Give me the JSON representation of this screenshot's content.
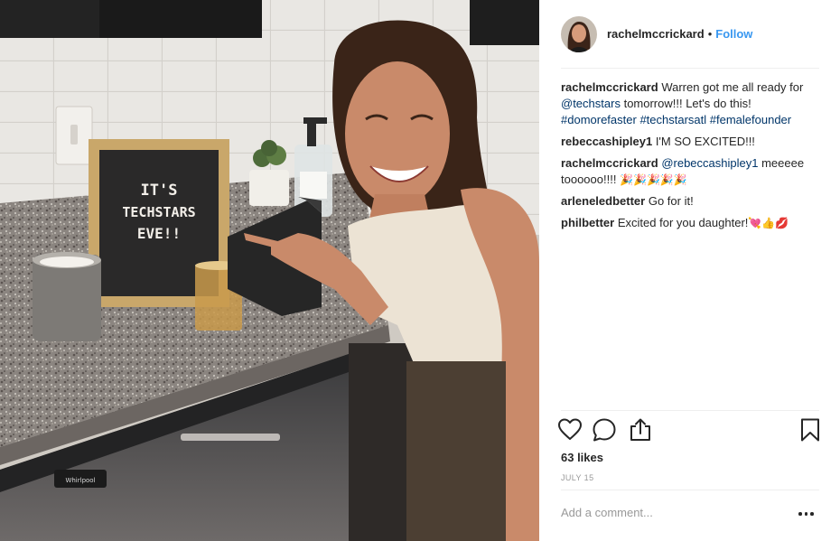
{
  "post": {
    "username": "rachelmccrickard",
    "separator": "•",
    "follow_label": "Follow",
    "comments": [
      {
        "user": "rachelmccrickard",
        "text_1": "Warren got me all ready for",
        "mention": "@techstars",
        "text_2": "tomorrow!!! Let's do this!",
        "tag_1": "#domorefaster",
        "tag_2": "#techstarsatl",
        "tag_3": "#femalefounder"
      },
      {
        "user": "rebeccashipley1",
        "text": "I'M SO EXCITED!!!"
      },
      {
        "user": "rachelmccrickard",
        "mention": "@rebeccashipley1",
        "text": "meeeee toooooo!!!!",
        "emoji": "🎉🎉🎉🎉🎉"
      },
      {
        "user": "arleneledbetter",
        "text": "Go for it!"
      },
      {
        "user": "philbetter",
        "text": "Excited for you daughter!",
        "emoji": "💘👍💋"
      }
    ],
    "likes": "63 likes",
    "date": "JULY 15",
    "comment_placeholder": "Add a comment...",
    "letter_board": [
      "IT'S",
      "TECHSTARS",
      "EVE!!"
    ],
    "brand_label": "Whirlpool"
  },
  "icons": {
    "like": "heart-icon",
    "comment": "speech-bubble-icon",
    "share": "share-icon",
    "save": "bookmark-icon",
    "more": "more-horizontal-icon"
  },
  "colors": {
    "link": "#3897f0",
    "mention": "#003569",
    "text": "#262626",
    "muted": "#999999",
    "divider": "#efefef"
  }
}
